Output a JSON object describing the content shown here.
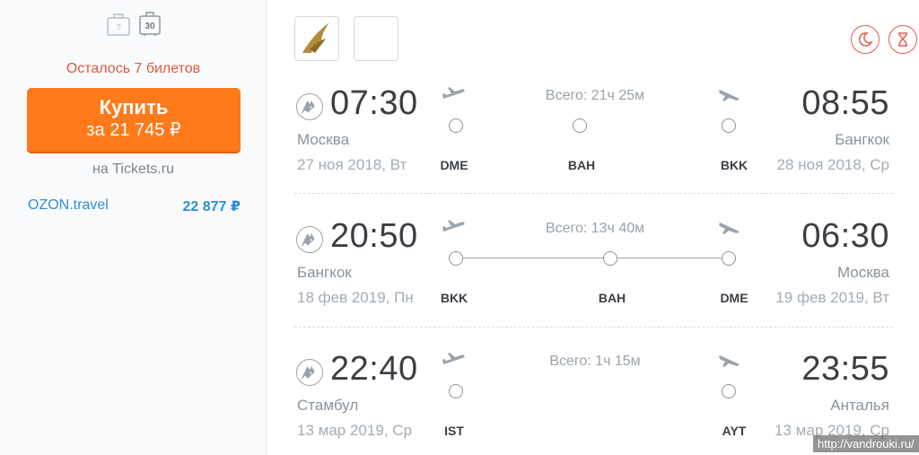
{
  "offer": {
    "tickets_left": "Осталось 7 билетов",
    "buy_line1": "Купить",
    "buy_line2": "за 21 745 ₽",
    "seller": "на Tickets.ru",
    "baggage_badge": "30",
    "baggage_unknown": "?",
    "alt_offer": {
      "name": "OZON.travel",
      "price": "22 877 ₽"
    }
  },
  "colors": {
    "accent": "#ff7a1a",
    "link": "#2c8fd1",
    "alert": "#e0583b"
  },
  "icons": {
    "night_flight": "moon-icon",
    "long_transfer": "hourglass-icon"
  },
  "segments": [
    {
      "dep_time": "07:30",
      "dep_city": "Москва",
      "dep_date": "27 ноя 2018, Вт",
      "dep_code": "DME",
      "arr_time": "08:55",
      "arr_city": "Бангкок",
      "arr_date": "28 ноя 2018, Ср",
      "arr_code": "BKK",
      "total": "Всего: 21ч 25м",
      "stop_code": "BAH"
    },
    {
      "dep_time": "20:50",
      "dep_city": "Бангкок",
      "dep_date": "18 фев 2019, Пн",
      "dep_code": "BKK",
      "arr_time": "06:30",
      "arr_city": "Москва",
      "arr_date": "19 фев 2019, Вт",
      "arr_code": "DME",
      "total": "Всего: 13ч 40м",
      "stop_code": "BAH"
    },
    {
      "dep_time": "22:40",
      "dep_city": "Стамбул",
      "dep_date": "13 мар 2019, Ср",
      "dep_code": "IST",
      "arr_time": "23:55",
      "arr_city": "Анталья",
      "arr_date": "13 мар 2019, Ср",
      "arr_code": "AYT",
      "total": "Всего: 1ч 15м",
      "stop_code": ""
    }
  ],
  "watermark": "http://vandrouki.ru/"
}
